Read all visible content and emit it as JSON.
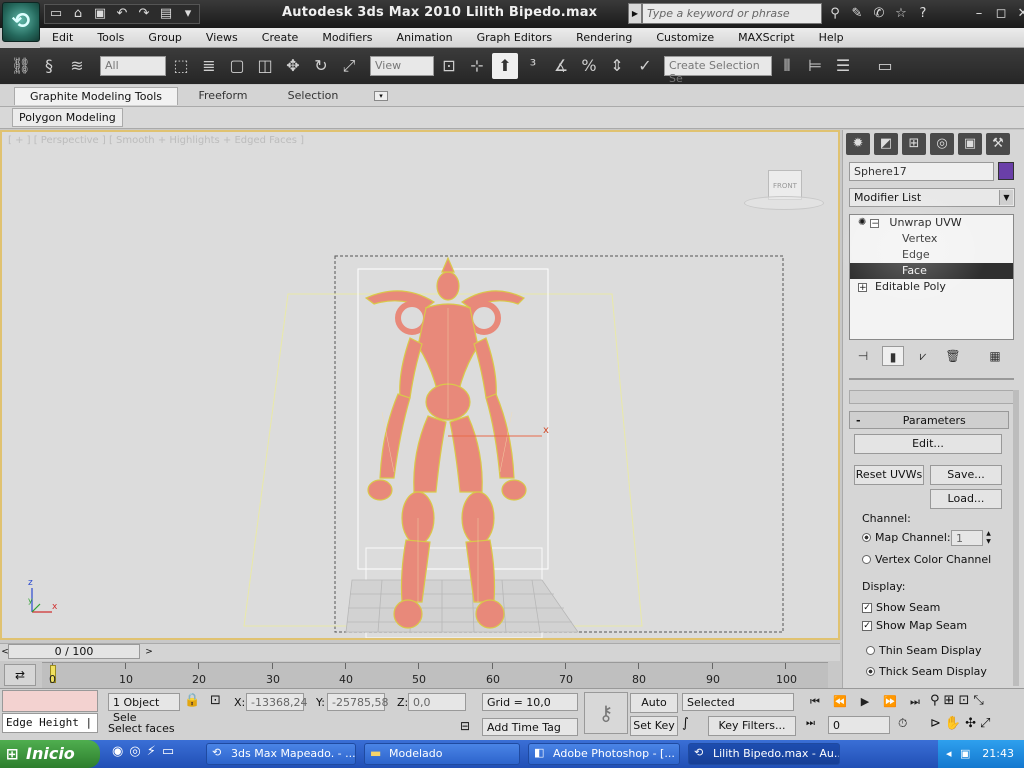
{
  "window": {
    "title": "Autodesk 3ds Max  2010      Lilith Bipedo.max",
    "search_placeholder": "Type a keyword or phrase",
    "controls": [
      "–",
      "◻",
      "✕"
    ]
  },
  "menu": [
    "Edit",
    "Tools",
    "Group",
    "Views",
    "Create",
    "Modifiers",
    "Animation",
    "Graph Editors",
    "Rendering",
    "Customize",
    "MAXScript",
    "Help"
  ],
  "toolbar": {
    "filter_value": "All",
    "coord_value": "View",
    "selection_set_placeholder": "Create Selection Se"
  },
  "ribbon": {
    "tabs": [
      "Graphite Modeling Tools",
      "Freeform",
      "Selection"
    ],
    "panel": "Polygon Modeling"
  },
  "viewport": {
    "label": "[ + ] [ Perspective ] [ Smooth + Highlights + Edged Faces ]",
    "viewcube_label": "FRONT",
    "axis_x": "x",
    "axis_z": "z",
    "axis_y": "y"
  },
  "command_panel": {
    "object_name": "Sphere17",
    "object_color": "#6a3fa8",
    "modifier_list": "Modifier List",
    "stack": {
      "modifier": "Unwrap UVW",
      "subs": [
        "Vertex",
        "Edge",
        "Face"
      ],
      "base": "Editable Poly"
    },
    "rollout_title": "Parameters",
    "edit_button": "Edit...",
    "reset_button": "Reset UVWs",
    "save_button": "Save...",
    "load_button": "Load...",
    "channel_label": "Channel:",
    "map_channel_label": "Map Channel:",
    "map_channel_value": "1",
    "vertex_color_label": "Vertex Color Channel",
    "display_label": "Display:",
    "show_seam": "Show Seam",
    "show_map_seam": "Show Map Seam",
    "thin_seam": "Thin Seam Display",
    "thick_seam": "Thick Seam Display"
  },
  "timeline": {
    "frame_counter": "0 / 100",
    "ticks": [
      "0",
      "10",
      "20",
      "30",
      "40",
      "50",
      "60",
      "70",
      "80",
      "90",
      "100"
    ]
  },
  "status": {
    "selection": "1 Object Sele",
    "x_label": "X:",
    "x_value": "-13368,24",
    "y_label": "Y:",
    "y_value": "-25785,58",
    "z_label": "Z:",
    "z_value": "0,0",
    "grid": "Grid = 10,0",
    "auto_key": "Auto Key",
    "set_key": "Set Key",
    "selected": "Selected",
    "key_filters": "Key Filters...",
    "frame_value": "0",
    "prompt": "Select faces",
    "add_time_tag": "Add Time Tag",
    "maxscript_listener": "Edge Height  |"
  },
  "taskbar": {
    "start": "Inicio",
    "tasks": [
      "3ds Max Mapeado. - ...",
      "Modelado",
      "Adobe Photoshop - [...",
      "Lilith Bipedo.max - Au..."
    ],
    "clock": "21:43"
  }
}
